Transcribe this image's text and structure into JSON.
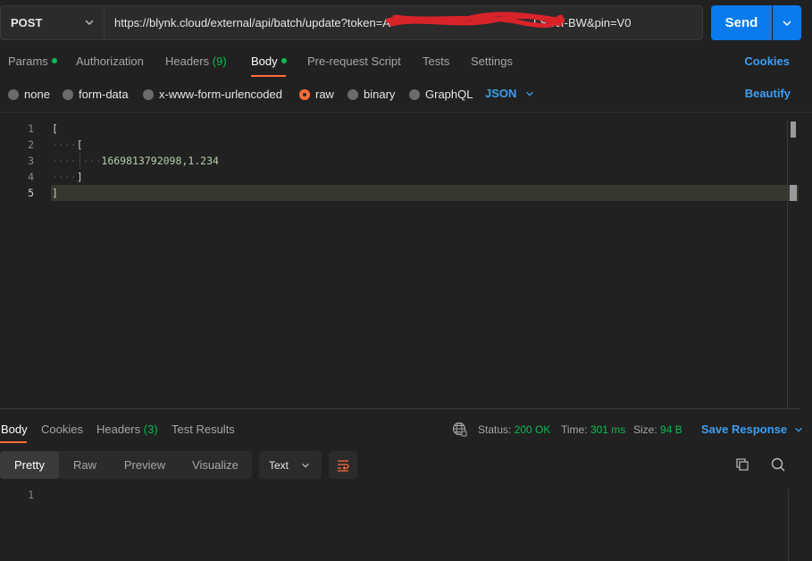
{
  "request": {
    "method": "POST",
    "url": "https://blynk.cloud/external/api/batch/update?token=A",
    "url_tail": "LSBcf-BW&pin=V0",
    "send_label": "Send"
  },
  "request_tabs": {
    "params": "Params",
    "authorization": "Authorization",
    "headers": "Headers",
    "headers_count": "(9)",
    "body": "Body",
    "pre_request": "Pre-request Script",
    "tests": "Tests",
    "settings": "Settings",
    "cookies": "Cookies"
  },
  "body_options": {
    "none": "none",
    "form_data": "form-data",
    "urlencoded": "x-www-form-urlencoded",
    "raw": "raw",
    "binary": "binary",
    "graphql": "GraphQL",
    "language": "JSON",
    "beautify": "Beautify",
    "selected": "raw"
  },
  "editor": {
    "line_numbers": [
      "1",
      "2",
      "3",
      "4",
      "5"
    ],
    "lines": [
      "[",
      "[",
      "1669813792098,1.234",
      "]",
      "]"
    ]
  },
  "response": {
    "tabs": {
      "body": "Body",
      "cookies": "Cookies",
      "headers": "Headers",
      "headers_count": "(3)",
      "test_results": "Test Results"
    },
    "status_label": "Status:",
    "status_value": "200 OK",
    "time_label": "Time:",
    "time_value": "301 ms",
    "size_label": "Size:",
    "size_value": "94 B",
    "save_response": "Save Response",
    "views": {
      "pretty": "Pretty",
      "raw": "Raw",
      "preview": "Preview",
      "visualize": "Visualize"
    },
    "format": "Text",
    "line_numbers": [
      "1"
    ]
  },
  "colors": {
    "accent": "#ff6c37",
    "link": "#3d9ef5",
    "send": "#097bed",
    "success": "#0cbb52"
  }
}
